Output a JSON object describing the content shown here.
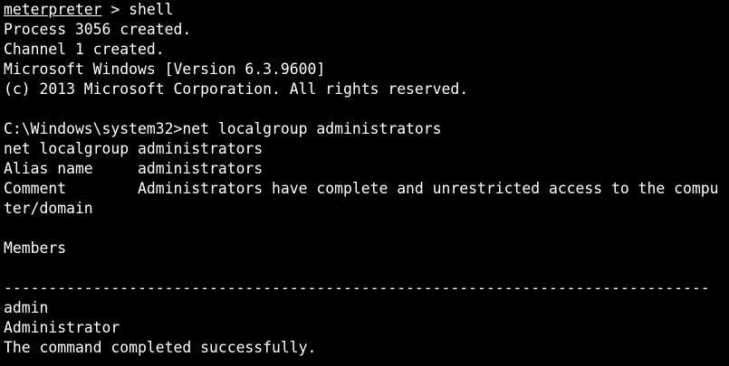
{
  "terminal": {
    "meterpreter_prompt": "meterpreter",
    "meterpreter_command": " > shell",
    "lines": [
      "Process 3056 created.",
      "Channel 1 created.",
      "Microsoft Windows [Version 6.3.9600]",
      "(c) 2013 Microsoft Corporation. All rights reserved.",
      "",
      "C:\\Windows\\system32>net localgroup administrators",
      "net localgroup administrators",
      "Alias name     administrators",
      "Comment        Administrators have complete and unrestricted access to the compu",
      "ter/domain",
      "",
      "Members",
      "",
      "-------------------------------------------------------------------------------",
      "admin",
      "Administrator",
      "The command completed successfully."
    ]
  }
}
